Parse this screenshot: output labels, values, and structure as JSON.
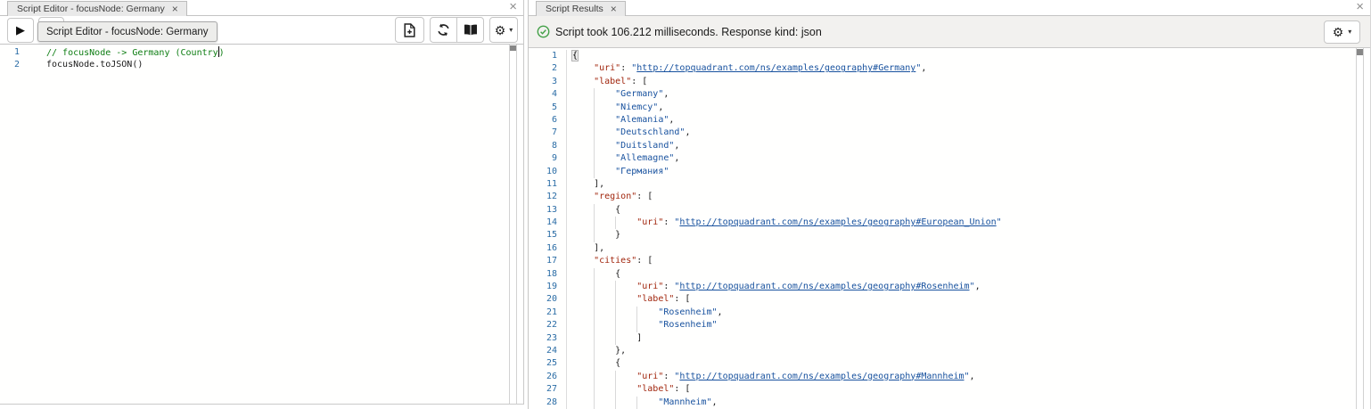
{
  "icons": {
    "close": "×",
    "tab_close": "×",
    "play": "▶",
    "gear": "⚙",
    "caret_down": "▾",
    "check_circle_color": "#43a047",
    "names": [
      "play-icon",
      "file-plus-icon",
      "refresh-icon",
      "book-icon",
      "gear-icon",
      "caret-down-icon",
      "check-circle-icon",
      "close-icon"
    ]
  },
  "colors": {
    "line_number": "#2a6ca5",
    "json_key": "#a1260d",
    "json_string": "#17519e",
    "comment": "#0d7d12",
    "status_bg": "#f2f1ef",
    "tab_bg": "#e9e9e9",
    "success_green": "#43a047"
  },
  "left_panel": {
    "tab": {
      "title": "Script Editor - focusNode: Germany"
    },
    "tooltip": "Script Editor - focusNode: Germany",
    "editor": {
      "lines": [
        {
          "i": 0,
          "t": [
            [
              "c",
              "// focusNode -> Germany (Country"
            ],
            [
              "cur",
              ""
            ],
            [
              "c",
              ")"
            ]
          ]
        },
        {
          "i": 0,
          "t": [
            [
              "d",
              "focusNode.toJSON()"
            ]
          ]
        }
      ]
    }
  },
  "right_panel": {
    "tab": {
      "title": "Script Results"
    },
    "status": {
      "text": "Script took 106.212 milliseconds. Response kind: json"
    },
    "editor": {
      "lines": [
        {
          "i": 0,
          "t": [
            [
              "m",
              "{"
            ]
          ]
        },
        {
          "i": 1,
          "t": [
            [
              "k",
              "\"uri\""
            ],
            [
              "p",
              ": "
            ],
            [
              "s",
              "\""
            ],
            [
              "l",
              "http://topquadrant.com/ns/examples/geography#Germany"
            ],
            [
              "s",
              "\""
            ],
            [
              "p",
              ","
            ]
          ]
        },
        {
          "i": 1,
          "t": [
            [
              "k",
              "\"label\""
            ],
            [
              "p",
              ": ["
            ]
          ]
        },
        {
          "i": 2,
          "t": [
            [
              "s",
              "\"Germany\""
            ],
            [
              "p",
              ","
            ]
          ]
        },
        {
          "i": 2,
          "t": [
            [
              "s",
              "\"Niemcy\""
            ],
            [
              "p",
              ","
            ]
          ]
        },
        {
          "i": 2,
          "t": [
            [
              "s",
              "\"Alemania\""
            ],
            [
              "p",
              ","
            ]
          ]
        },
        {
          "i": 2,
          "t": [
            [
              "s",
              "\"Deutschland\""
            ],
            [
              "p",
              ","
            ]
          ]
        },
        {
          "i": 2,
          "t": [
            [
              "s",
              "\"Duitsland\""
            ],
            [
              "p",
              ","
            ]
          ]
        },
        {
          "i": 2,
          "t": [
            [
              "s",
              "\"Allemagne\""
            ],
            [
              "p",
              ","
            ]
          ]
        },
        {
          "i": 2,
          "t": [
            [
              "s",
              "\"Германия\""
            ]
          ]
        },
        {
          "i": 1,
          "t": [
            [
              "p",
              "],"
            ]
          ]
        },
        {
          "i": 1,
          "t": [
            [
              "k",
              "\"region\""
            ],
            [
              "p",
              ": ["
            ]
          ]
        },
        {
          "i": 2,
          "t": [
            [
              "p",
              "{"
            ]
          ]
        },
        {
          "i": 3,
          "t": [
            [
              "k",
              "\"uri\""
            ],
            [
              "p",
              ": "
            ],
            [
              "s",
              "\""
            ],
            [
              "l",
              "http://topquadrant.com/ns/examples/geography#European_Union"
            ],
            [
              "s",
              "\""
            ]
          ]
        },
        {
          "i": 2,
          "t": [
            [
              "p",
              "}"
            ]
          ]
        },
        {
          "i": 1,
          "t": [
            [
              "p",
              "],"
            ]
          ]
        },
        {
          "i": 1,
          "t": [
            [
              "k",
              "\"cities\""
            ],
            [
              "p",
              ": ["
            ]
          ]
        },
        {
          "i": 2,
          "t": [
            [
              "p",
              "{"
            ]
          ]
        },
        {
          "i": 3,
          "t": [
            [
              "k",
              "\"uri\""
            ],
            [
              "p",
              ": "
            ],
            [
              "s",
              "\""
            ],
            [
              "l",
              "http://topquadrant.com/ns/examples/geography#Rosenheim"
            ],
            [
              "s",
              "\""
            ],
            [
              "p",
              ","
            ]
          ]
        },
        {
          "i": 3,
          "t": [
            [
              "k",
              "\"label\""
            ],
            [
              "p",
              ": ["
            ]
          ]
        },
        {
          "i": 4,
          "t": [
            [
              "s",
              "\"Rosenheim\""
            ],
            [
              "p",
              ","
            ]
          ]
        },
        {
          "i": 4,
          "t": [
            [
              "s",
              "\"Rosenheim\""
            ]
          ]
        },
        {
          "i": 3,
          "t": [
            [
              "p",
              "]"
            ]
          ]
        },
        {
          "i": 2,
          "t": [
            [
              "p",
              "},"
            ]
          ]
        },
        {
          "i": 2,
          "t": [
            [
              "p",
              "{"
            ]
          ]
        },
        {
          "i": 3,
          "t": [
            [
              "k",
              "\"uri\""
            ],
            [
              "p",
              ": "
            ],
            [
              "s",
              "\""
            ],
            [
              "l",
              "http://topquadrant.com/ns/examples/geography#Mannheim"
            ],
            [
              "s",
              "\""
            ],
            [
              "p",
              ","
            ]
          ]
        },
        {
          "i": 3,
          "t": [
            [
              "k",
              "\"label\""
            ],
            [
              "p",
              ": ["
            ]
          ]
        },
        {
          "i": 4,
          "t": [
            [
              "s",
              "\"Mannheim\""
            ],
            [
              "p",
              ","
            ]
          ]
        }
      ]
    }
  }
}
